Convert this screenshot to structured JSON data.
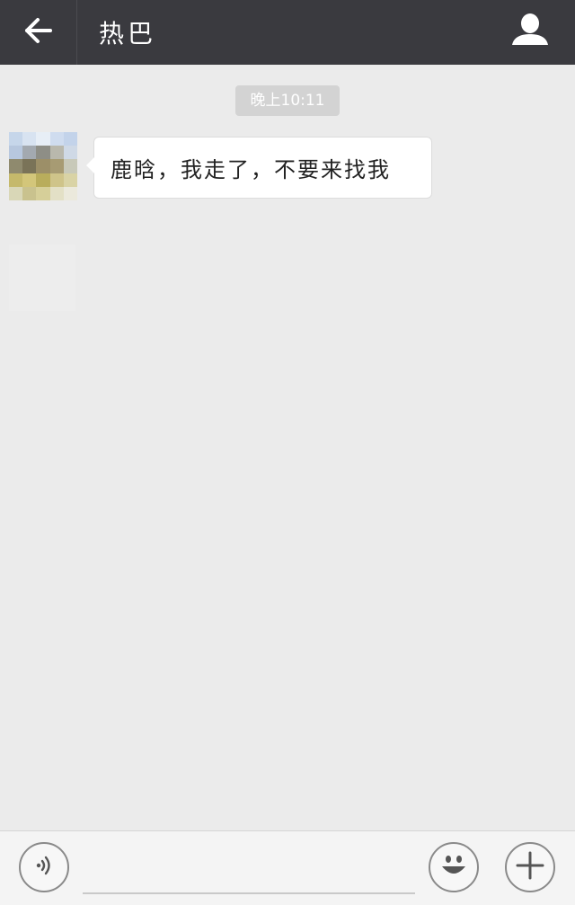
{
  "header": {
    "title": "热巴",
    "back_icon": "arrow-left-icon",
    "profile_icon": "user-profile-icon"
  },
  "chat": {
    "timestamp": "晚上10:11",
    "messages": [
      {
        "sender": "contact",
        "avatar_icon": "contact-avatar",
        "text": "鹿晗，我走了，不要来找我"
      }
    ]
  },
  "input_bar": {
    "voice_icon": "voice-icon",
    "text_value": "",
    "emoji_icon": "emoji-icon",
    "plus_icon": "plus-icon"
  },
  "colors": {
    "topbar_bg": "#3a3a3f",
    "chat_bg": "#ebebeb",
    "bubble_bg": "#ffffff",
    "timestamp_bg": "#d3d3d3",
    "bottombar_bg": "#f4f4f4"
  }
}
